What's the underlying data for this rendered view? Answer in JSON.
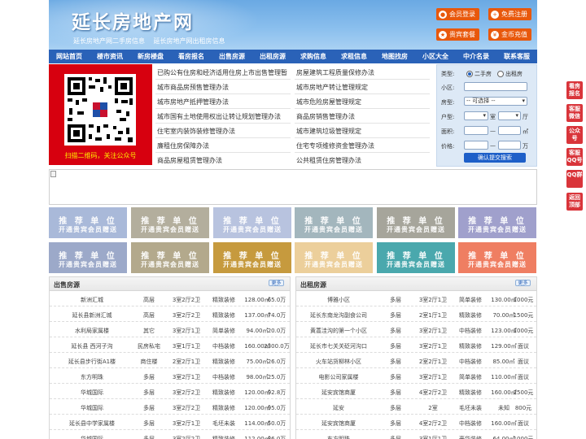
{
  "header": {
    "logo": "延长房地产网",
    "links": [
      "延长房地产网二手房信息",
      "延长房地产网出租房信息"
    ],
    "buttons": [
      "会员登录",
      "免费注册",
      "贵宾套餐",
      "金币充值"
    ]
  },
  "nav": [
    "网站首页",
    "楼市资讯",
    "新房楼盘",
    "看房报名",
    "出售房源",
    "出租房源",
    "求购信息",
    "求租信息",
    "地图找房",
    "小区大全",
    "中介名录",
    "联系客服"
  ],
  "qr": {
    "caption": "扫描二维码，关注公众号"
  },
  "notices": {
    "left": [
      "已购公有住房和经济适用住房上市出售管理暂",
      "城市商品房预售管理办法",
      "城市房地产抵押管理办法",
      "城市国有土地使用权出让转让规划管理办法",
      "住宅室内装饰装修管理办法",
      "廉租住房保障办法",
      "商品房屋租赁管理办法"
    ],
    "right": [
      "房屋建筑工程质量保修办法",
      "城市房地产转让管理规定",
      "城市危险房屋管理规定",
      "商品房销售管理办法",
      "城市建筑垃圾管理规定",
      "住宅专项维修资金管理办法",
      "公共租赁住房管理办法"
    ]
  },
  "search": {
    "type_label": "类型:",
    "type_options": [
      "二手房",
      "出租房"
    ],
    "community_label": "小区:",
    "housetype_label": "房型:",
    "housetype_value": "-- 可选择 --",
    "layout_label": "户型:",
    "room_unit": "室",
    "hall_unit": "厅",
    "area_label": "面积:",
    "area_unit": "㎡",
    "area_sep": "—",
    "price_label": "价格:",
    "price_unit": "万",
    "price_sep": "—",
    "submit": "确认提交搜索"
  },
  "recommend": {
    "line1": "推 荐 单 位",
    "line2": "开通贵宾会员赠送",
    "colors": [
      "#a9b9d9",
      "#b3ae9d",
      "#b8c3df",
      "#a3b6bd",
      "#a6a59b",
      "#a0a0cc",
      "#9ca9c9",
      "#b3a98c",
      "#c69a3e",
      "#eccf9b",
      "#4aa8ad",
      "#ef7e62"
    ]
  },
  "sale": {
    "title": "出售房源",
    "more": "更多",
    "rows": [
      [
        "新洲汇城",
        "高层",
        "3室2厅2卫",
        "精致装修",
        "128.00㎡",
        "65.0万"
      ],
      [
        "延长县新洲汇城",
        "高层",
        "3室2厅2卫",
        "精致装修",
        "137.00㎡",
        "74.0万"
      ],
      [
        "水利局家属楼",
        "其它",
        "3室2厅1卫",
        "简单装修",
        "94.00㎡",
        "20.0万"
      ],
      [
        "延长县 西河子沟",
        "民房私宅",
        "3室1厅1卫",
        "中档装修",
        "160.00㎡",
        "2300.0万"
      ],
      [
        "延长县步行街A1楼",
        "商住楼",
        "2室2厅1卫",
        "精致装修",
        "75.00㎡",
        "26.0万"
      ],
      [
        "东方明珠",
        "多层",
        "3室2厅1卫",
        "中档装修",
        "98.00㎡",
        "25.0万"
      ],
      [
        "华城国际",
        "多层",
        "3室2厅2卫",
        "精致装修",
        "120.00㎡",
        "92.8万"
      ],
      [
        "华城国际",
        "多层",
        "3室2厅2卫",
        "精致装修",
        "120.00㎡",
        "95.0万"
      ],
      [
        "延长县中学家属楼",
        "多层",
        "3室2厅1卫",
        "毛坯未装",
        "114.00㎡",
        "50.0万"
      ],
      [
        "华城国际",
        "多层",
        "3室2厅2卫",
        "精致装修",
        "112.00㎡",
        "86.0万"
      ]
    ]
  },
  "rent": {
    "title": "出租房源",
    "more": "更多",
    "rows": [
      [
        "博雅小区",
        "多层",
        "3室2厅1卫",
        "简单装修",
        "130.00㎡",
        "1000元"
      ],
      [
        "延长东南龙沟副食公司",
        "多层",
        "2室1厅1卫",
        "精致装修",
        "70.00㎡",
        "1500元"
      ],
      [
        "黄蒿洼沟的第一个小区",
        "多层",
        "3室2厅1卫",
        "中档装修",
        "123.00㎡",
        "1000元"
      ],
      [
        "延长市七关关砭河沟口",
        "多层",
        "3室2厅1卫",
        "精致装修",
        "129.00㎡",
        "面议"
      ],
      [
        "火车站货柳林小区",
        "多层",
        "2室2厅1卫",
        "中档装修",
        "85.00㎡",
        "面议"
      ],
      [
        "电影公司家属楼",
        "多层",
        "3室2厅1卫",
        "简单装修",
        "110.00㎡",
        "面议"
      ],
      [
        "延安宾馆商厦",
        "多层",
        "4室2厅2卫",
        "精致装修",
        "160.00㎡",
        "2500元"
      ],
      [
        "延安",
        "多层",
        "2室",
        "毛坯未装",
        "未知",
        "800元"
      ],
      [
        "延安宾馆商厦",
        "多层",
        "4室2厅2卫",
        "中档装修",
        "160.00㎡",
        "面议"
      ],
      [
        "东方明珠",
        "多层",
        "3室1厅1卫",
        "豪华装修",
        "64.00㎡",
        "1000元"
      ]
    ]
  },
  "side": [
    "看房报名",
    "客服微信",
    "公众号",
    "客服QQ号",
    "QQ群",
    "返回顶部"
  ]
}
